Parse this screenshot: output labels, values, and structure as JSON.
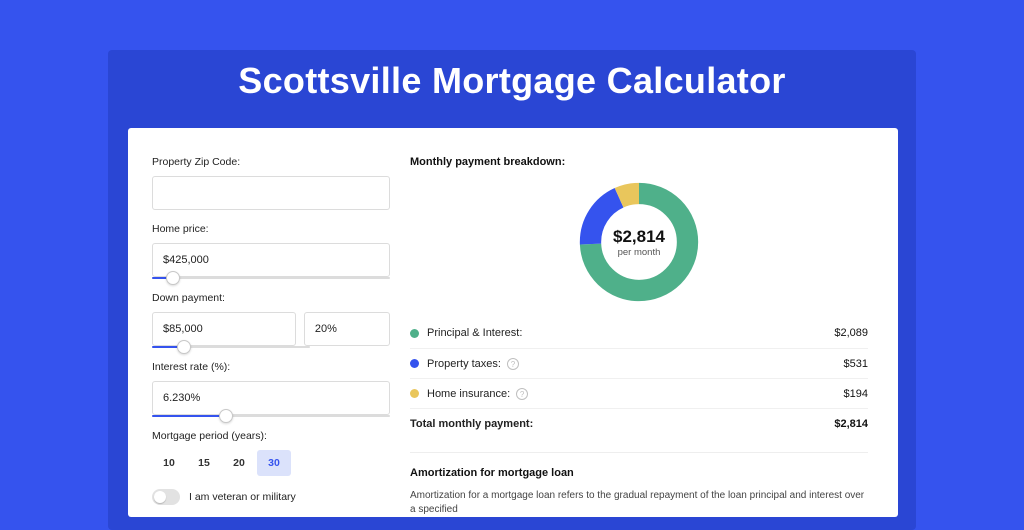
{
  "heading": "Scottsville Mortgage Calculator",
  "form": {
    "zip_label": "Property Zip Code:",
    "zip_value": "",
    "price_label": "Home price:",
    "price_value": "$425,000",
    "price_slider_pct": 9,
    "down_label": "Down payment:",
    "down_value": "$85,000",
    "down_pct_value": "20%",
    "down_slider_pct": 20,
    "rate_label": "Interest rate (%):",
    "rate_value": "6.230%",
    "rate_slider_pct": 31,
    "period_label": "Mortgage period (years):",
    "periods": [
      "10",
      "15",
      "20",
      "30"
    ],
    "period_selected": "30",
    "veteran_label": "I am veteran or military",
    "veteran_on": false
  },
  "breakdown": {
    "title": "Monthly payment breakdown:",
    "center_value": "$2,814",
    "center_sub": "per month",
    "items": [
      {
        "name": "Principal & Interest:",
        "amount": "$2,089",
        "color": "green",
        "info": false
      },
      {
        "name": "Property taxes:",
        "amount": "$531",
        "color": "blue",
        "info": true
      },
      {
        "name": "Home insurance:",
        "amount": "$194",
        "color": "yellow",
        "info": true
      }
    ],
    "total_label": "Total monthly payment:",
    "total_amount": "$2,814"
  },
  "amort": {
    "title": "Amortization for mortgage loan",
    "text": "Amortization for a mortgage loan refers to the gradual repayment of the loan principal and interest over a specified"
  },
  "chart_data": {
    "type": "pie",
    "title": "Monthly payment breakdown",
    "categories": [
      "Principal & Interest",
      "Property taxes",
      "Home insurance"
    ],
    "values": [
      2089,
      531,
      194
    ],
    "total": 2814,
    "colors": [
      "#4fb08a",
      "#3553ee",
      "#e9c65c"
    ]
  }
}
